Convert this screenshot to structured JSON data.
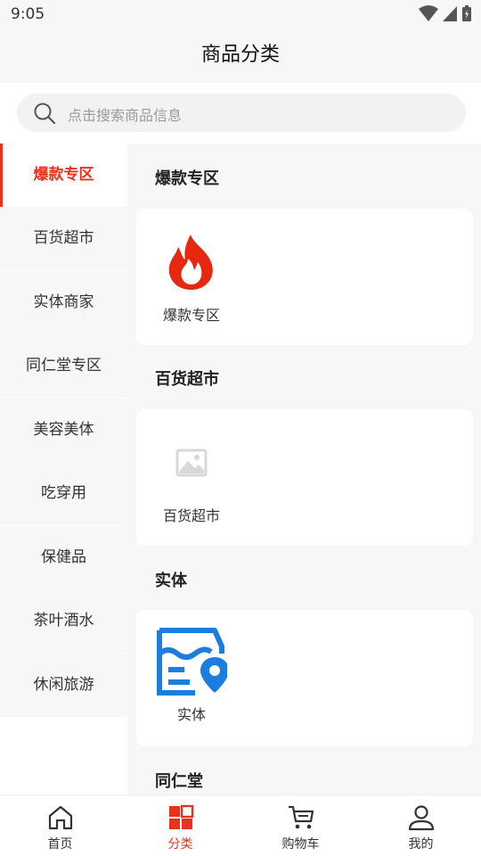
{
  "status_bar": {
    "time": "9:05"
  },
  "header": {
    "title": "商品分类"
  },
  "search": {
    "placeholder": "点击搜索商品信息"
  },
  "sidebar": {
    "items": [
      {
        "label": "爆款专区",
        "active": true
      },
      {
        "label": "百货超市"
      },
      {
        "label": "实体商家"
      },
      {
        "label": "同仁堂专区"
      },
      {
        "label": "美容美体"
      },
      {
        "label": "吃穿用"
      },
      {
        "label": "保健品"
      },
      {
        "label": "茶叶酒水"
      },
      {
        "label": "休闲旅游"
      }
    ]
  },
  "content": {
    "sections": [
      {
        "title": "爆款专区",
        "items": [
          {
            "label": "爆款专区",
            "icon": "fire-icon"
          }
        ]
      },
      {
        "title": "百货超市",
        "items": [
          {
            "label": "百货超市",
            "icon": "image-placeholder-icon"
          }
        ]
      },
      {
        "title": "实体",
        "items": [
          {
            "label": "实体",
            "icon": "store-location-icon"
          }
        ]
      },
      {
        "title": "同仁堂"
      }
    ]
  },
  "bottom_nav": {
    "items": [
      {
        "label": "首页",
        "icon": "home-icon"
      },
      {
        "label": "分类",
        "icon": "category-grid-icon",
        "active": true
      },
      {
        "label": "购物车",
        "icon": "cart-icon"
      },
      {
        "label": "我的",
        "icon": "user-icon"
      }
    ]
  },
  "colors": {
    "accent": "#e8321e",
    "fire": "#e62810",
    "store_blue": "#1a7ee0"
  }
}
